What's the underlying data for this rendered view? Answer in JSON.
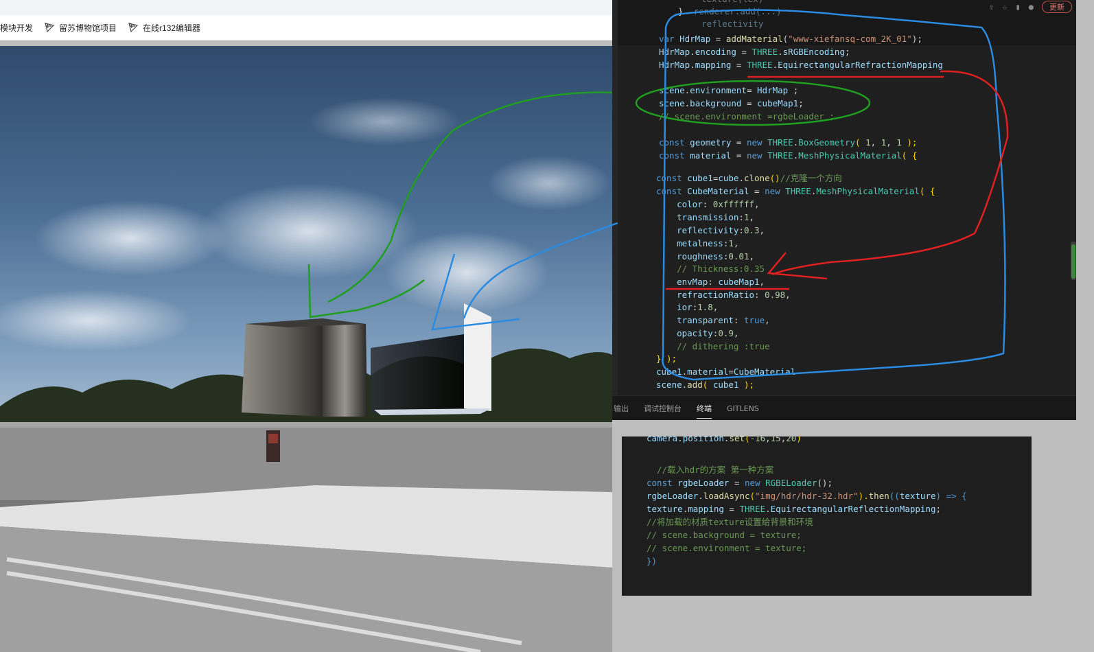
{
  "bookmarks": [
    {
      "label": "模块开发",
      "icon": "none"
    },
    {
      "label": "留苏博物馆项目",
      "icon": "threejs-logo-icon"
    },
    {
      "label": "在线r132编辑器",
      "icon": "threejs-logo-icon"
    }
  ],
  "editor": {
    "update_button": "更新",
    "lines": [
      [
        [
          "texture(tex)",
          "dim p"
        ]
      ],
      [
        [
          "}",
          "p"
        ],
        [
          "  renderer.add(...)",
          "dim v"
        ]
      ],
      [
        [
          "  reflectivity",
          "dim v"
        ]
      ],
      [
        [
          "var",
          "k"
        ],
        [
          " ",
          "p"
        ],
        [
          "HdrMap",
          "v"
        ],
        [
          " = ",
          "p"
        ],
        [
          "addMaterial",
          "f"
        ],
        [
          "(",
          "p"
        ],
        [
          "\"www-xiefansq-com_2K_01\"",
          "s"
        ],
        [
          ");",
          "p"
        ]
      ],
      [
        [
          "HdrMap",
          "v"
        ],
        [
          ".",
          "p"
        ],
        [
          "encoding",
          "v"
        ],
        [
          " = ",
          "p"
        ],
        [
          "THREE",
          "t"
        ],
        [
          ".",
          "p"
        ],
        [
          "sRGBEncoding",
          "v"
        ],
        [
          ";",
          "p"
        ]
      ],
      [
        [
          "HdrMap",
          "v"
        ],
        [
          ".",
          "p"
        ],
        [
          "mapping",
          "v"
        ],
        [
          " = ",
          "p"
        ],
        [
          "THREE",
          "t"
        ],
        [
          ".",
          "p"
        ],
        [
          "EquirectangularRefractionMapping",
          "v"
        ]
      ],
      [],
      [
        [
          "scene",
          "v"
        ],
        [
          ".",
          "p"
        ],
        [
          "environment",
          "v"
        ],
        [
          "= ",
          "p"
        ],
        [
          "HdrMap",
          "v"
        ],
        [
          " ;",
          "p"
        ]
      ],
      [
        [
          "scene",
          "v"
        ],
        [
          ".",
          "p"
        ],
        [
          "background",
          "v"
        ],
        [
          " = ",
          "p"
        ],
        [
          "cubeMap1",
          "v"
        ],
        [
          ";",
          "p"
        ]
      ],
      [
        [
          "// scene.environment =rgbeLoader ;",
          "c"
        ]
      ],
      [],
      [
        [
          "const",
          "k"
        ],
        [
          " ",
          "p"
        ],
        [
          "geometry",
          "v"
        ],
        [
          " = ",
          "p"
        ],
        [
          "new",
          "k"
        ],
        [
          " ",
          "p"
        ],
        [
          "THREE",
          "t"
        ],
        [
          ".",
          "p"
        ],
        [
          "BoxGeometry",
          "t"
        ],
        [
          "( ",
          "y"
        ],
        [
          "1",
          "n"
        ],
        [
          ", ",
          "p"
        ],
        [
          "1",
          "n"
        ],
        [
          ", ",
          "p"
        ],
        [
          "1",
          "n"
        ],
        [
          " );",
          "y"
        ]
      ],
      [
        [
          "const",
          "k"
        ],
        [
          " ",
          "p"
        ],
        [
          "material",
          "v"
        ],
        [
          " = ",
          "p"
        ],
        [
          "new",
          "k"
        ],
        [
          " ",
          "p"
        ],
        [
          "THREE",
          "t"
        ],
        [
          ".",
          "p"
        ],
        [
          "MeshPhysicalMaterial",
          "t"
        ],
        [
          "( {",
          "y"
        ]
      ],
      [
        [
          "const",
          "k"
        ],
        [
          " ",
          "p"
        ],
        [
          "cube1",
          "v"
        ],
        [
          "=",
          "p"
        ],
        [
          "cube",
          "v"
        ],
        [
          ".",
          "p"
        ],
        [
          "clone",
          "f"
        ],
        [
          "()",
          "y"
        ],
        [
          "//克隆一个方向",
          "c"
        ]
      ],
      [
        [
          "const",
          "k"
        ],
        [
          " ",
          "p"
        ],
        [
          "CubeMaterial",
          "v"
        ],
        [
          " = ",
          "p"
        ],
        [
          "new",
          "k"
        ],
        [
          " ",
          "p"
        ],
        [
          "THREE",
          "t"
        ],
        [
          ".",
          "p"
        ],
        [
          "MeshPhysicalMaterial",
          "t"
        ],
        [
          "( {",
          "y"
        ]
      ],
      [
        [
          "    color",
          "v"
        ],
        [
          ": ",
          "p"
        ],
        [
          "0xffffff",
          "n"
        ],
        [
          ",",
          "p"
        ]
      ],
      [
        [
          "    transmission",
          "v"
        ],
        [
          ":",
          "p"
        ],
        [
          "1",
          "n"
        ],
        [
          ",",
          "p"
        ]
      ],
      [
        [
          "    reflectivity",
          "v"
        ],
        [
          ":",
          "p"
        ],
        [
          "0.3",
          "n"
        ],
        [
          ",",
          "p"
        ]
      ],
      [
        [
          "    metalness",
          "v"
        ],
        [
          ":",
          "p"
        ],
        [
          "1",
          "n"
        ],
        [
          ",",
          "p"
        ]
      ],
      [
        [
          "    roughness",
          "v"
        ],
        [
          ":",
          "p"
        ],
        [
          "0.01",
          "n"
        ],
        [
          ",",
          "p"
        ]
      ],
      [
        [
          "    // Thickness:0.35",
          "c"
        ]
      ],
      [
        [
          "    envMap",
          "v"
        ],
        [
          ": ",
          "p"
        ],
        [
          "cubeMap1",
          "v"
        ],
        [
          ",",
          "p"
        ]
      ],
      [
        [
          "    refractionRatio",
          "v"
        ],
        [
          ": ",
          "p"
        ],
        [
          "0.98",
          "n"
        ],
        [
          ",",
          "p"
        ]
      ],
      [
        [
          "    ior",
          "v"
        ],
        [
          ":",
          "p"
        ],
        [
          "1.8",
          "n"
        ],
        [
          ",",
          "p"
        ]
      ],
      [
        [
          "    transparent",
          "v"
        ],
        [
          ": ",
          "p"
        ],
        [
          "true",
          "k"
        ],
        [
          ",",
          "p"
        ]
      ],
      [
        [
          "    opacity",
          "v"
        ],
        [
          ":",
          "p"
        ],
        [
          "0.9",
          "n"
        ],
        [
          ",",
          "p"
        ]
      ],
      [
        [
          "    // dithering :true",
          "c"
        ]
      ],
      [
        [
          "} );",
          "y"
        ]
      ],
      [
        [
          "cube1",
          "v"
        ],
        [
          ".",
          "p"
        ],
        [
          "material",
          "v"
        ],
        [
          "=",
          "p"
        ],
        [
          "CubeMaterial",
          "v"
        ]
      ],
      [
        [
          "scene",
          "v"
        ],
        [
          ".",
          "p"
        ],
        [
          "add",
          "f"
        ],
        [
          "( ",
          "y"
        ],
        [
          "cube1",
          "v"
        ],
        [
          " );",
          "y"
        ]
      ]
    ]
  },
  "panel_tabs": [
    {
      "label": "输出",
      "active": false
    },
    {
      "label": "调试控制台",
      "active": false
    },
    {
      "label": "终端",
      "active": true
    },
    {
      "label": "GITLENS",
      "active": false
    }
  ],
  "snippet": {
    "lines": [
      [
        [
          "camera",
          "v"
        ],
        [
          ".",
          "p"
        ],
        [
          "position",
          "v"
        ],
        [
          ".",
          "p"
        ],
        [
          "set",
          "f"
        ],
        [
          "(",
          "y"
        ],
        [
          "-16",
          "n"
        ],
        [
          ",",
          "p"
        ],
        [
          "15",
          "n"
        ],
        [
          ",",
          "p"
        ],
        [
          "20",
          "n"
        ],
        [
          ")",
          "y"
        ]
      ],
      [],
      [
        [
          "  //载入hdr的方案 第一种方案",
          "c"
        ]
      ],
      [
        [
          "const",
          "k"
        ],
        [
          " ",
          "p"
        ],
        [
          "rgbeLoader",
          "v"
        ],
        [
          " = ",
          "p"
        ],
        [
          "new",
          "k"
        ],
        [
          " ",
          "p"
        ],
        [
          "RGBELoader",
          "t"
        ],
        [
          "();",
          "p"
        ]
      ],
      [
        [
          "rgbeLoader",
          "v"
        ],
        [
          ".",
          "p"
        ],
        [
          "loadAsync",
          "f"
        ],
        [
          "(",
          "y"
        ],
        [
          "\"img/hdr/hdr-32.hdr\"",
          "s"
        ],
        [
          ").",
          "y"
        ],
        [
          "then",
          "f"
        ],
        [
          "((",
          "k"
        ],
        [
          "texture",
          "v"
        ],
        [
          ") ",
          "k"
        ],
        [
          "=>",
          "k"
        ],
        [
          " {",
          "k"
        ]
      ],
      [
        [
          "texture",
          "v"
        ],
        [
          ".",
          "p"
        ],
        [
          "mapping",
          "v"
        ],
        [
          " = ",
          "p"
        ],
        [
          "THREE",
          "t"
        ],
        [
          ".",
          "p"
        ],
        [
          "EquirectangularReflectionMapping",
          "v"
        ],
        [
          ";",
          "p"
        ]
      ],
      [
        [
          "//将加载的材质texture设置给背景和环境",
          "c"
        ]
      ],
      [
        [
          "// scene.background = texture;",
          "c"
        ]
      ],
      [
        [
          "// scene.environment = texture;",
          "c"
        ]
      ],
      [
        [
          "})",
          "k"
        ]
      ]
    ]
  }
}
